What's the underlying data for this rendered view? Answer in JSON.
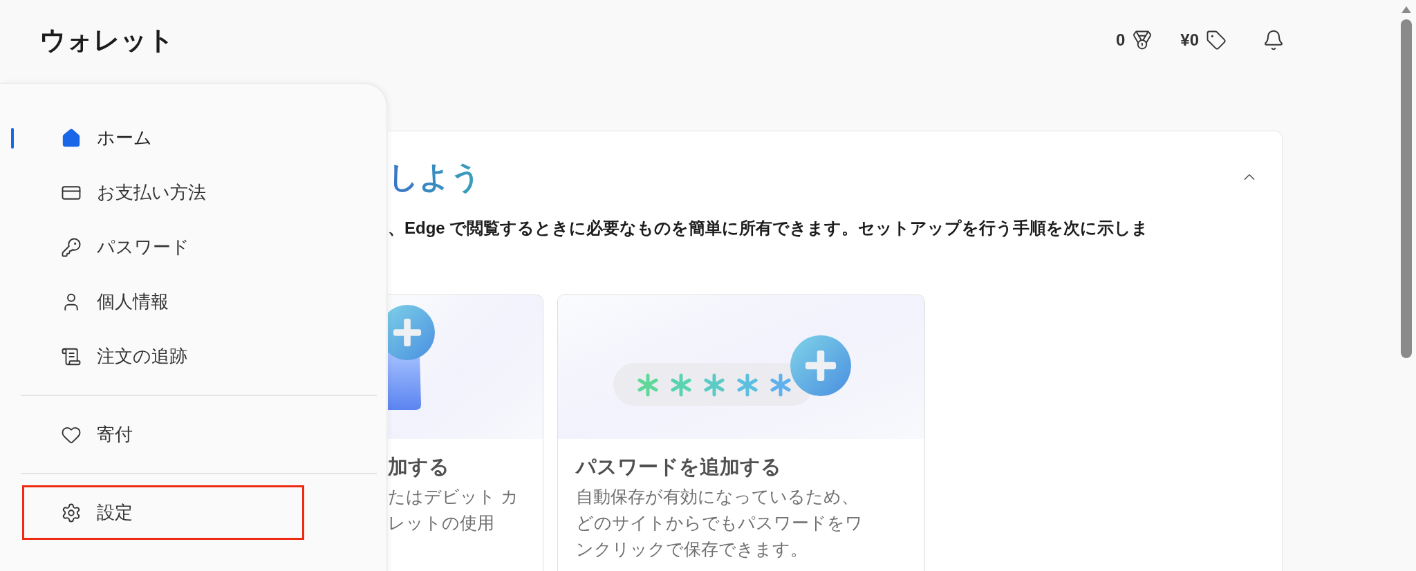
{
  "app_title": "ウォレット",
  "header": {
    "stats": [
      "0",
      "¥0"
    ]
  },
  "sidebar": {
    "sections": [
      {
        "items": [
          {
            "label": "ホーム",
            "selected": true,
            "highlighted": false
          },
          {
            "label": "お支払い方法",
            "selected": false,
            "highlighted": false
          },
          {
            "label": "パスワード",
            "selected": false,
            "highlighted": false
          },
          {
            "label": "個人情報",
            "selected": false,
            "highlighted": false
          },
          {
            "label": "注文の追跡",
            "selected": false,
            "highlighted": false
          }
        ]
      },
      {
        "items": [
          {
            "label": "寄付",
            "selected": false,
            "highlighted": false
          }
        ]
      },
      {
        "items": [
          {
            "label": "設定",
            "selected": false,
            "highlighted": true
          }
        ]
      }
    ]
  },
  "setup_card": {
    "title": "しよう",
    "expanded": true,
    "description": "、Edge で閲覧するときに必要なものを簡単に所有できます。セットアップを行う手順を次に示しま",
    "steps": [
      {
        "title": "加する",
        "lines": [
          "たはデビット カ",
          "レットの使用"
        ]
      },
      {
        "title": "パスワードを追加する",
        "lines": [
          "自動保存が有効になっているため、",
          "どのサイトからでもパスワードをワ",
          "ンクリックで保存できます。"
        ]
      }
    ]
  }
}
